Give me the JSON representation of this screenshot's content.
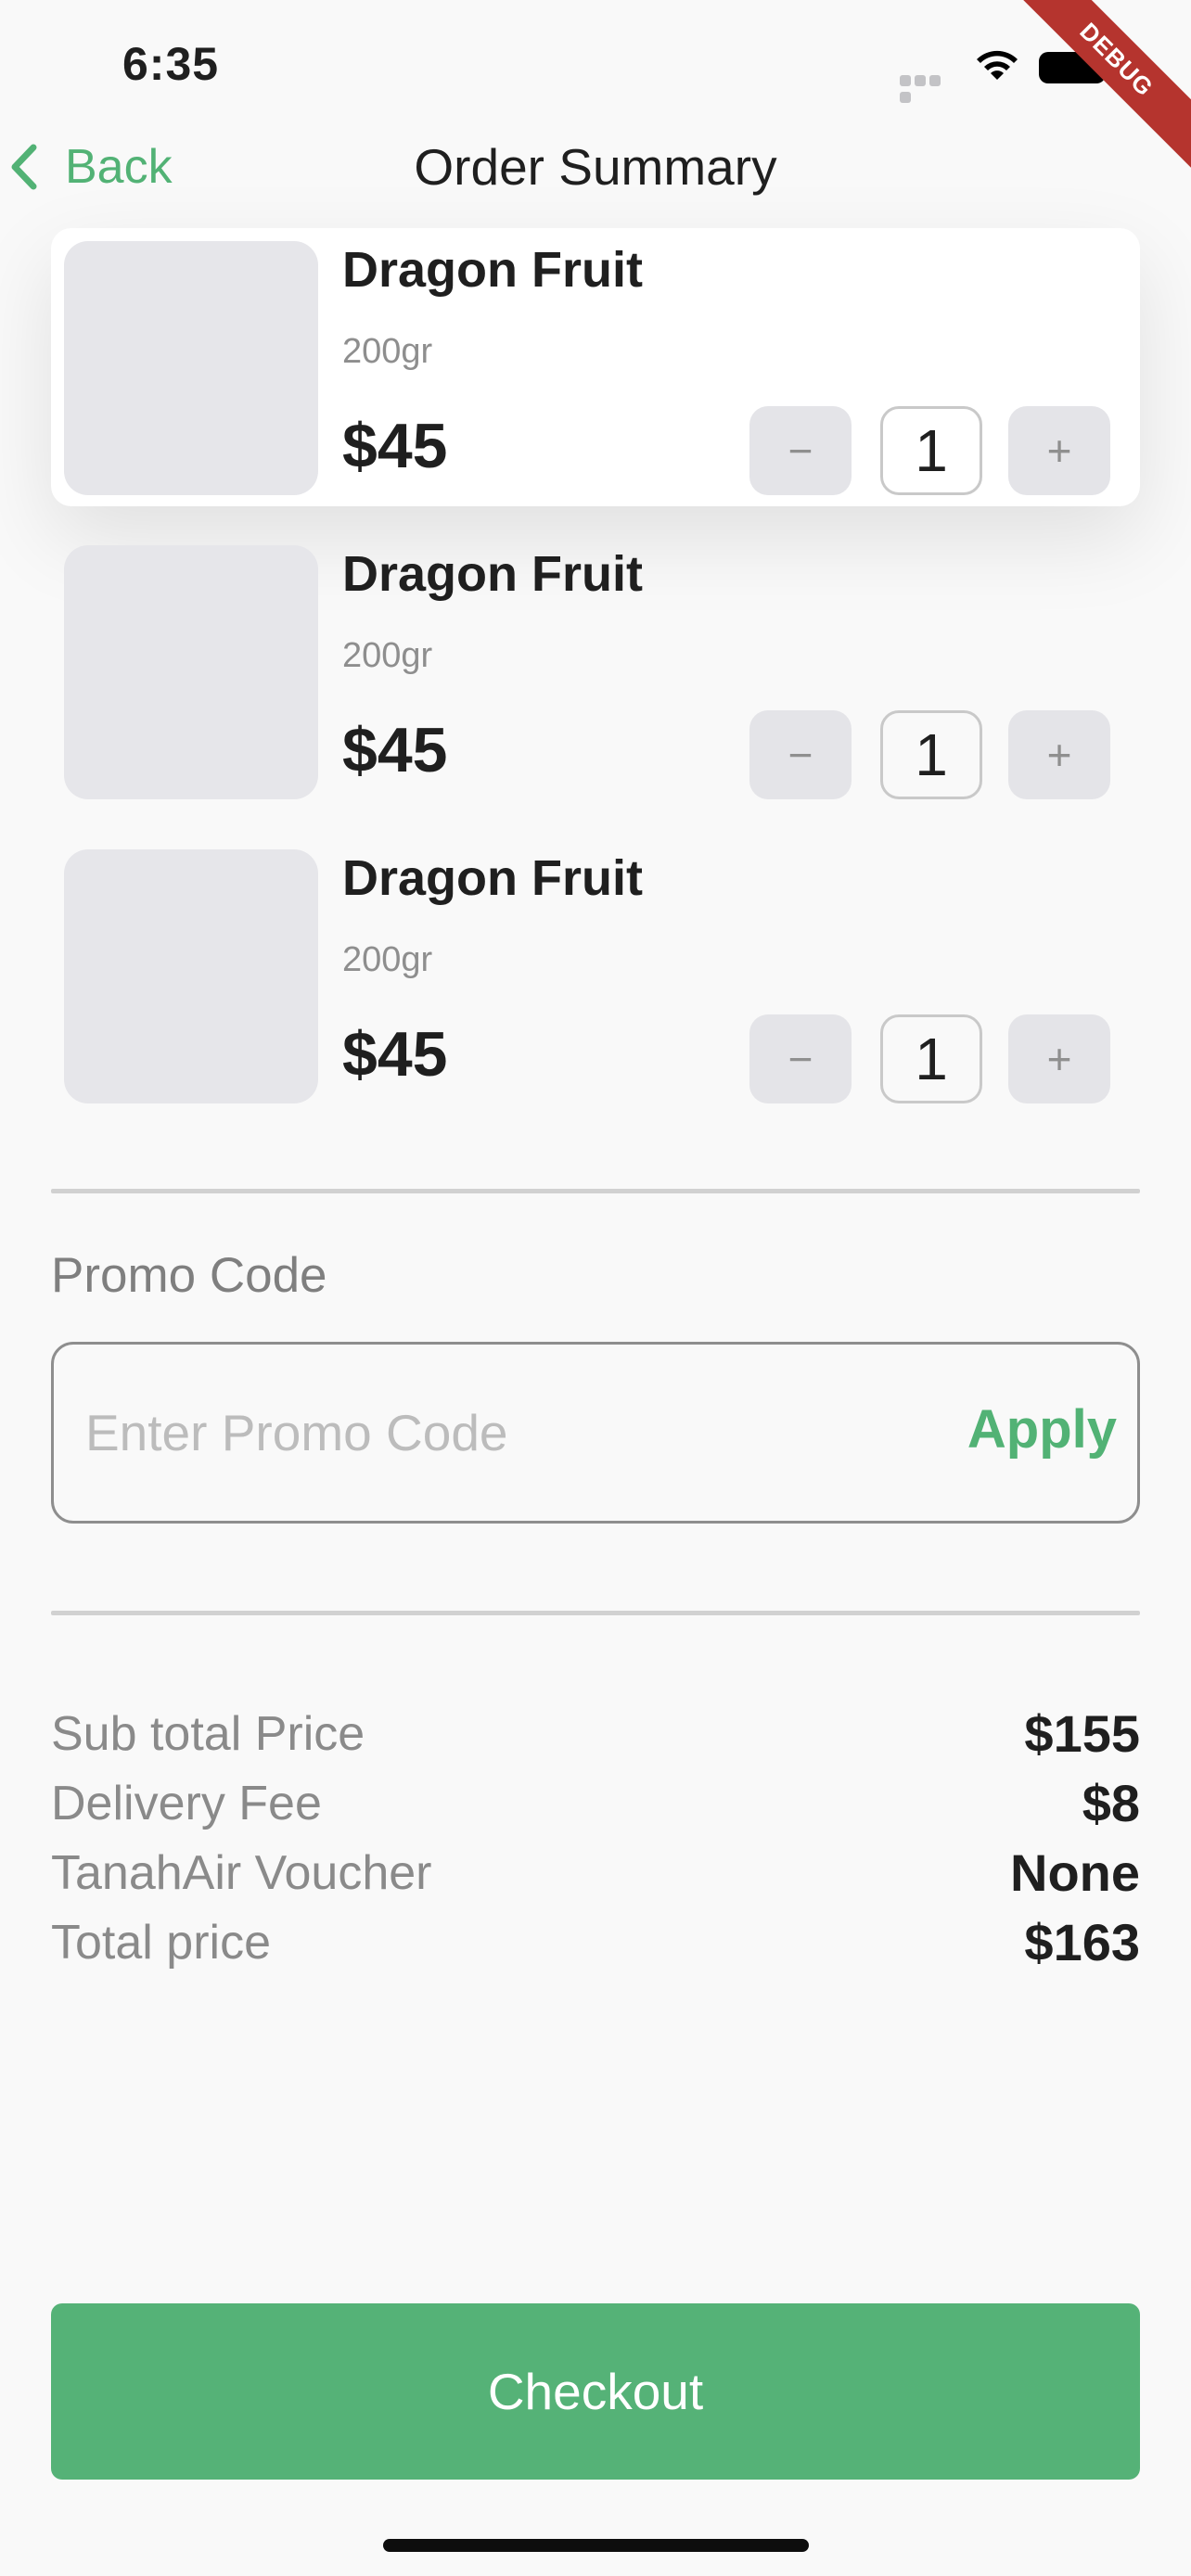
{
  "status_bar": {
    "time": "6:35",
    "debug_label": "DEBUG"
  },
  "nav": {
    "back_label": "Back",
    "title": "Order Summary"
  },
  "items": [
    {
      "name": "Dragon Fruit",
      "weight": "200gr",
      "price": "$45",
      "quantity": "1",
      "minus": "−",
      "plus": "+"
    },
    {
      "name": "Dragon Fruit",
      "weight": "200gr",
      "price": "$45",
      "quantity": "1",
      "minus": "−",
      "plus": "+"
    },
    {
      "name": "Dragon Fruit",
      "weight": "200gr",
      "price": "$45",
      "quantity": "1",
      "minus": "−",
      "plus": "+"
    }
  ],
  "promo": {
    "label": "Promo Code",
    "placeholder": "Enter Promo Code",
    "value": "",
    "apply_label": "Apply"
  },
  "summary": [
    {
      "label": "Sub total Price",
      "value": "$155"
    },
    {
      "label": "Delivery Fee",
      "value": "$8"
    },
    {
      "label": "TanahAir Voucher",
      "value": "None"
    },
    {
      "label": "Total price",
      "value": "$163"
    }
  ],
  "checkout_label": "Checkout",
  "colors": {
    "accent": "#52b275",
    "button_bg": "#55b277",
    "placeholder_bg": "#e6e6ea",
    "debug_ribbon": "#b5342e"
  },
  "icons": {
    "back": "chevron-left-icon",
    "wifi": "wifi-icon",
    "battery": "battery-icon",
    "signal": "cellular-signal-icon"
  }
}
